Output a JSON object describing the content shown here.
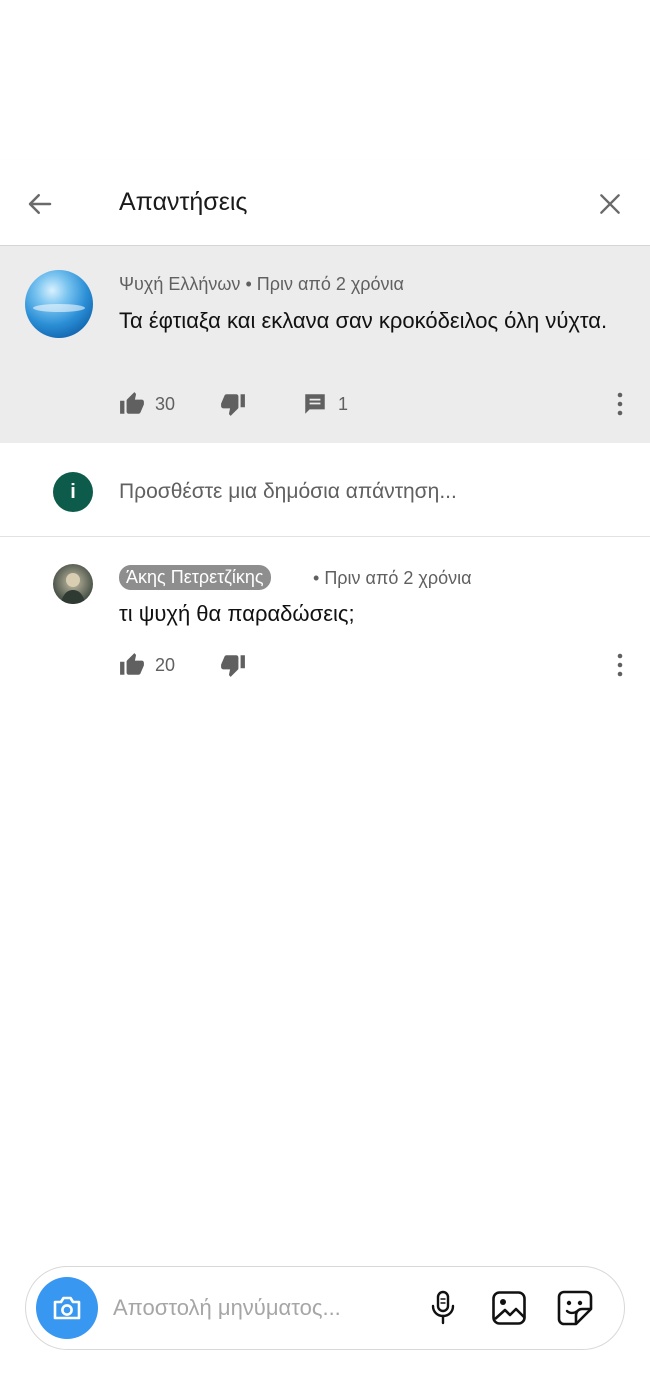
{
  "header": {
    "title": "Απαντήσεις",
    "back_icon": "arrow-left-icon",
    "close_icon": "close-icon"
  },
  "main_comment": {
    "author": "Ψυχή Ελλήνων",
    "time": "Πριν από 2 χρόνια",
    "text": "Τα έφτιαξα και εκλανα σαν κροκόδειλος όλη νύχτα.",
    "likes": "30",
    "replies": "1"
  },
  "reply_input": {
    "avatar_letter": "i",
    "placeholder": "Προσθέστε μια δημόσια απάντηση..."
  },
  "replies": [
    {
      "author": "Άκης Πετρετζίκης",
      "time": "Πριν από 2 χρόνια",
      "text": "τι ψυχή θα παραδώσεις;",
      "likes": "20"
    }
  ],
  "composer": {
    "placeholder": "Αποστολή μηνύματος...",
    "icons": [
      "camera-icon",
      "microphone-icon",
      "image-icon",
      "sticker-icon"
    ]
  },
  "colors": {
    "accent_blue": "#3897f0",
    "highlight_bg": "#ececec",
    "info_avatar": "#0d5b4a",
    "author_badge": "#8e8e8e"
  }
}
